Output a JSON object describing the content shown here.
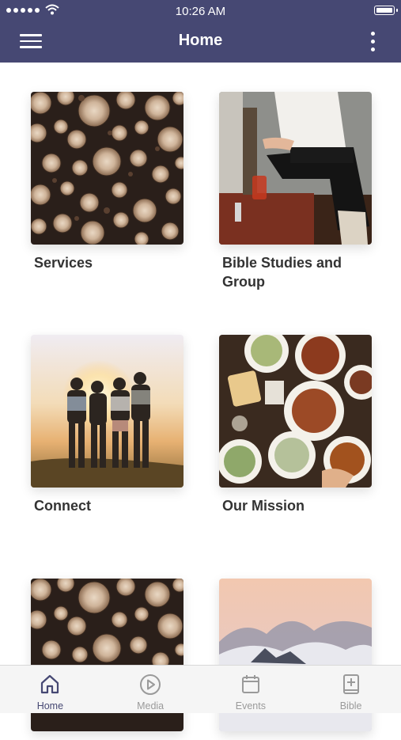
{
  "status_bar": {
    "time": "10:26 AM"
  },
  "header": {
    "title": "Home",
    "background": "#464873"
  },
  "tiles": [
    {
      "label": "Services",
      "image": "logs"
    },
    {
      "label": "Bible Studies and Group",
      "image": "person-chair"
    },
    {
      "label": "Connect",
      "image": "friends-sunset"
    },
    {
      "label": "Our Mission",
      "image": "food-table"
    },
    {
      "label": "",
      "image": "logs"
    },
    {
      "label": "",
      "image": "mountain-clouds"
    }
  ],
  "tab_bar": {
    "items": [
      {
        "label": "Home",
        "icon": "house-icon",
        "active": true
      },
      {
        "label": "Media",
        "icon": "play-circle-icon",
        "active": false
      },
      {
        "label": "Events",
        "icon": "calendar-icon",
        "active": false
      },
      {
        "label": "Bible",
        "icon": "bible-plus-icon",
        "active": false
      }
    ],
    "active_color": "#464873"
  }
}
